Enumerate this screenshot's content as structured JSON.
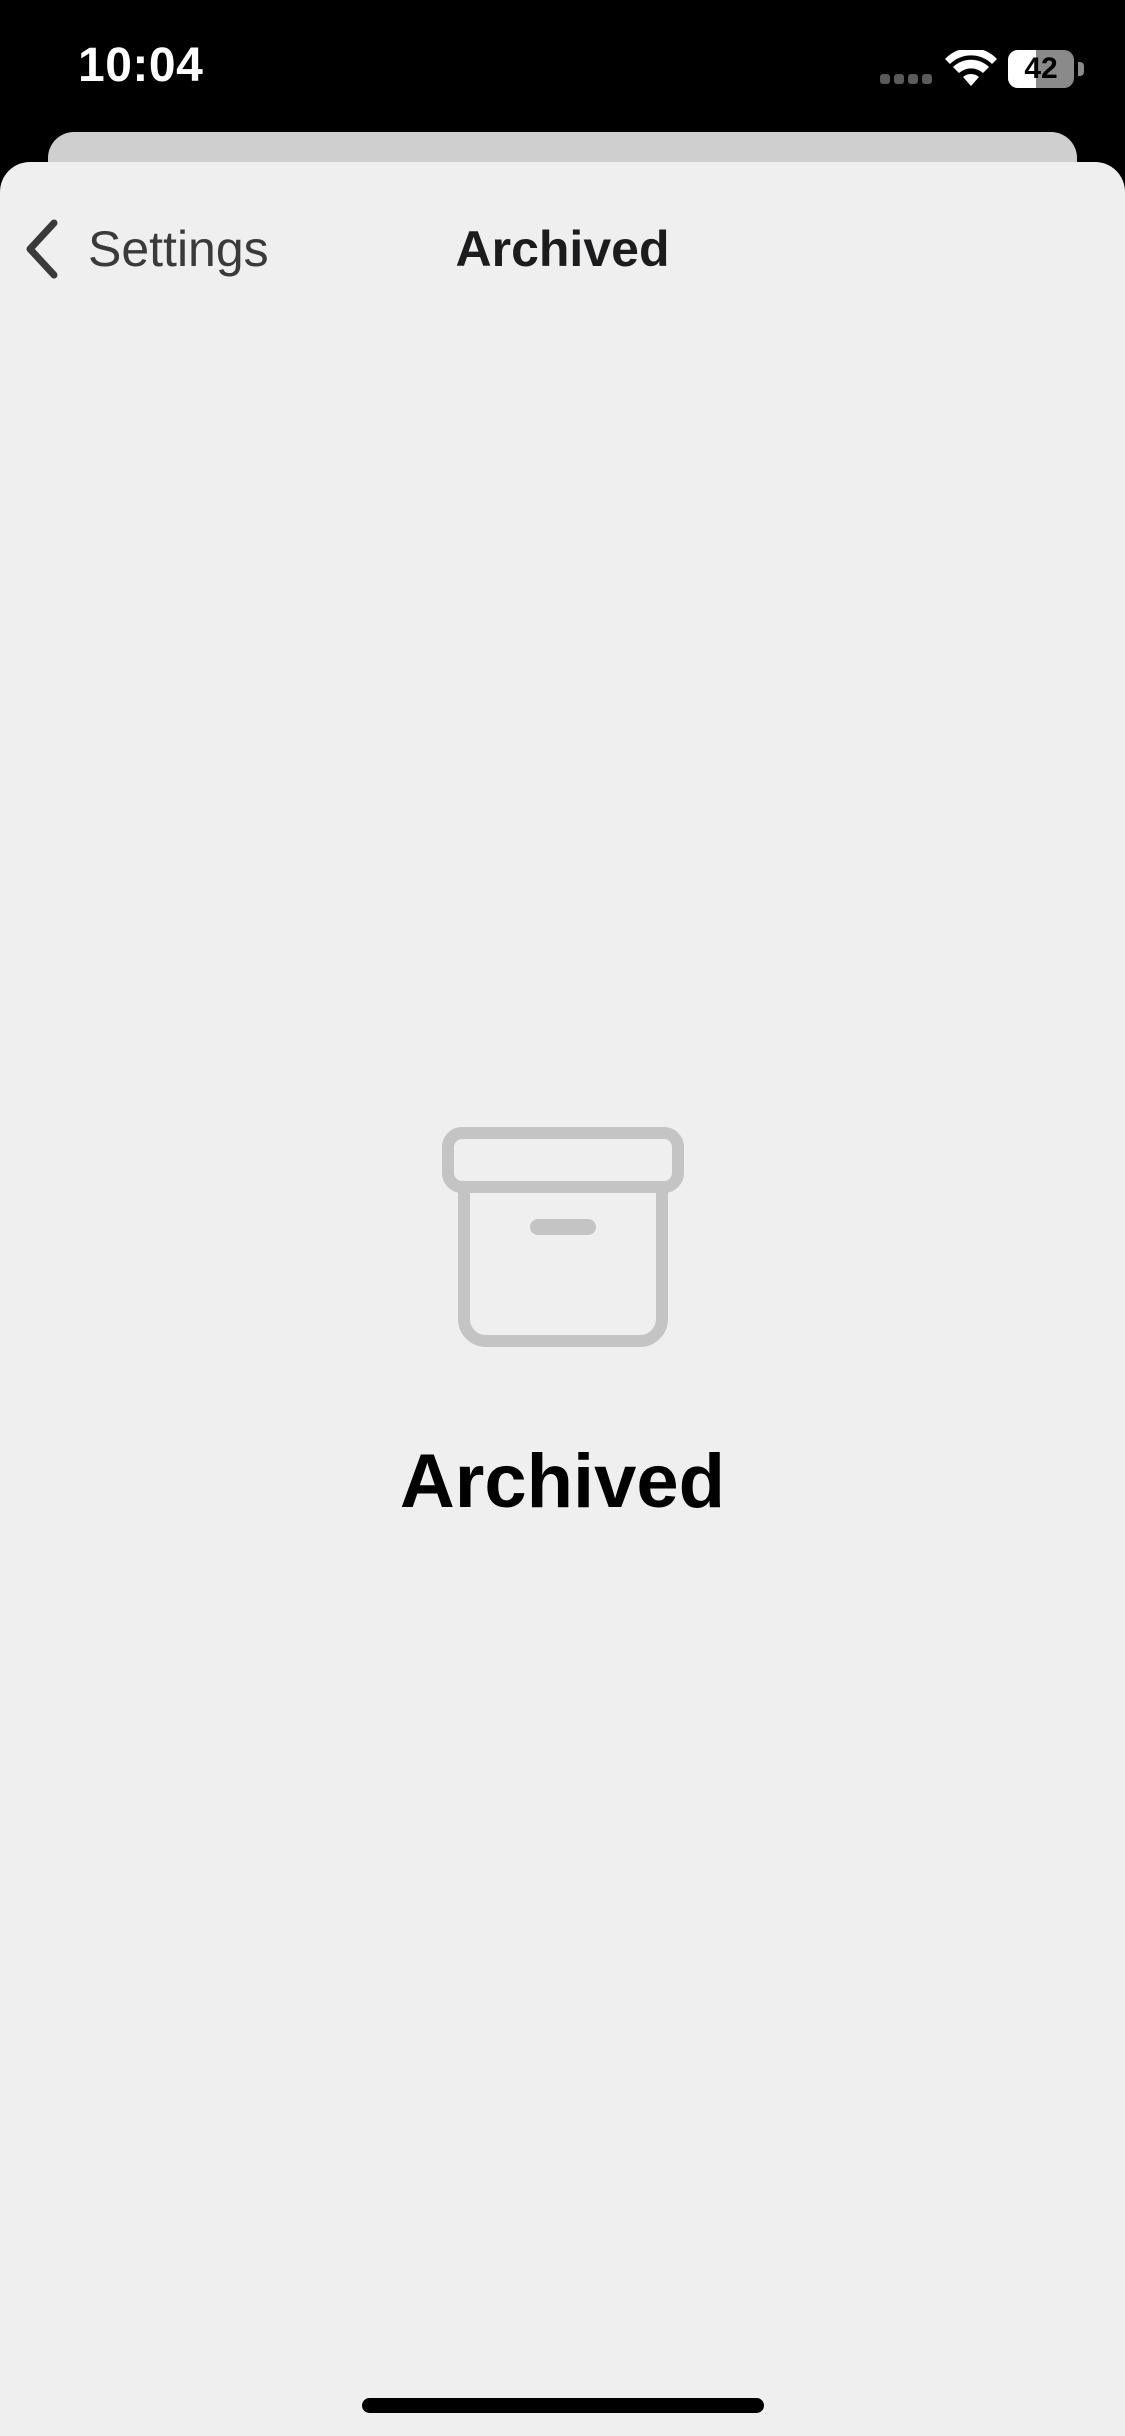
{
  "status_bar": {
    "time": "10:04",
    "battery_level": "42",
    "battery_fraction": 0.42,
    "signal_icon": "cellular-signal-icon",
    "wifi_icon": "wifi-icon"
  },
  "nav": {
    "back_label": "Settings",
    "back_icon": "chevron-left-icon",
    "title": "Archived"
  },
  "empty_state": {
    "icon": "archive-box-icon",
    "title": "Archived"
  },
  "colors": {
    "background": "#efefef",
    "icon": "#c4c4c4",
    "text_primary": "#000000",
    "text_secondary": "#3a3a3c"
  }
}
